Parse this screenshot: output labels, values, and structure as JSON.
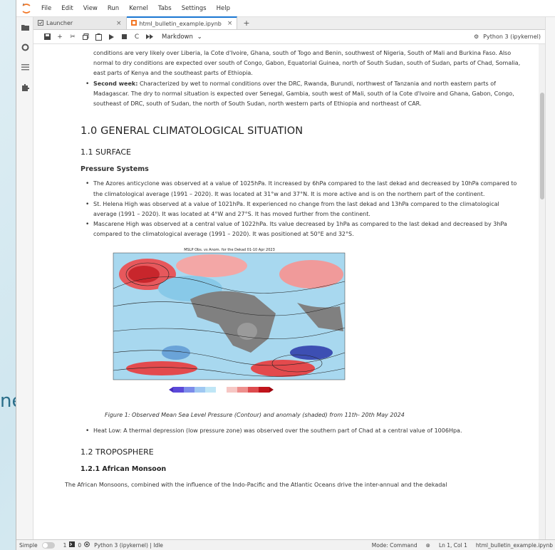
{
  "background": {
    "partial_text": "ne"
  },
  "menu": [
    "File",
    "Edit",
    "View",
    "Run",
    "Kernel",
    "Tabs",
    "Settings",
    "Help"
  ],
  "tabs": [
    {
      "label": "Launcher"
    },
    {
      "label": "html_bulletin_example.ipynb"
    }
  ],
  "toolbar": {
    "cell_type": "Markdown",
    "kernel": "Python 3 (ipykernel)"
  },
  "content": {
    "first_para_tail": "conditions are very likely over Liberia, la Cote d'Ivoire, Ghana, south of Togo and Benin, southwest of Nigeria, South of Mali and Burkina Faso. Also normal to dry conditions are expected over south of Congo, Gabon, Equatorial Guinea, north of South Sudan, south of Sudan, parts of Chad, Somalia, east parts of Kenya and the southeast parts of Ethiopia.",
    "second_week_label": "Second week:",
    "second_week_text": " Characterized by wet to normal conditions over the DRC, Rwanda, Burundi, northwest of Tanzania and north eastern parts of Madagascar. The dry to normal situation is expected over Senegal, Gambia, south west of Mali, south of la Cote d'Ivoire and Ghana, Gabon, Congo, southeast of DRC, south of Sudan, the north of South Sudan, north western parts of Ethiopia and northeast of CAR.",
    "h1": "1.0 GENERAL CLIMATOLOGICAL SITUATION",
    "h2_surface": "1.1 SURFACE",
    "h3_pressure": "Pressure Systems",
    "bullets": [
      "The Azores anticyclone was observed at a value of 1025hPa. It increased by 6hPa compared to the last dekad and decreased by 10hPa compared to the climatological average (1991 – 2020). It was located at 31°w and 37°N. It is more active and is on the northern part of the continent.",
      "St. Helena High was observed at a value of 1021hPa. It experienced no change from the last dekad and 13hPa compared to the climatological average (1991 – 2020). It was located at 4°W and 27°S. It has moved further from the continent.",
      "Mascarene High was observed at a central value of 1022hPa. Its value decreased by 1hPa as compared to the last dekad and decreased by 3hPa compared to the climatological average (1991 – 2020). It was positioned at 50°E and 32°S."
    ],
    "figure_title": "MSLP Obs. vs Anom. for the Dekad 01-10 Apr 2023",
    "figure_caption": "Figure 1: Observed Mean Sea Level Pressure (Contour) and anomaly (shaded) from 11th- 20th May 2024",
    "heat_low": "Heat Low: A thermal depression (low pressure zone) was observed over the southern part of Chad at a central value of 1006Hpa.",
    "h2_tropo": "1.2 TROPOSPHERE",
    "h3_monsoon": "1.2.1 African Monsoon",
    "monsoon_text": "The African Monsoons, combined with the influence of the Indo-Pacific and the Atlantic Oceans drive the inter-annual and the dekadal"
  },
  "statusbar": {
    "mode_label": "Simple",
    "count1": "1",
    "count2": "0",
    "kernel_status": "Python 3 (ipykernel) | Idle",
    "mode": "Mode: Command",
    "position": "Ln 1, Col 1",
    "filename": "html_bulletin_example.ipynb"
  },
  "colors": {
    "accent": "#1976d2",
    "logo": "#f37726"
  }
}
